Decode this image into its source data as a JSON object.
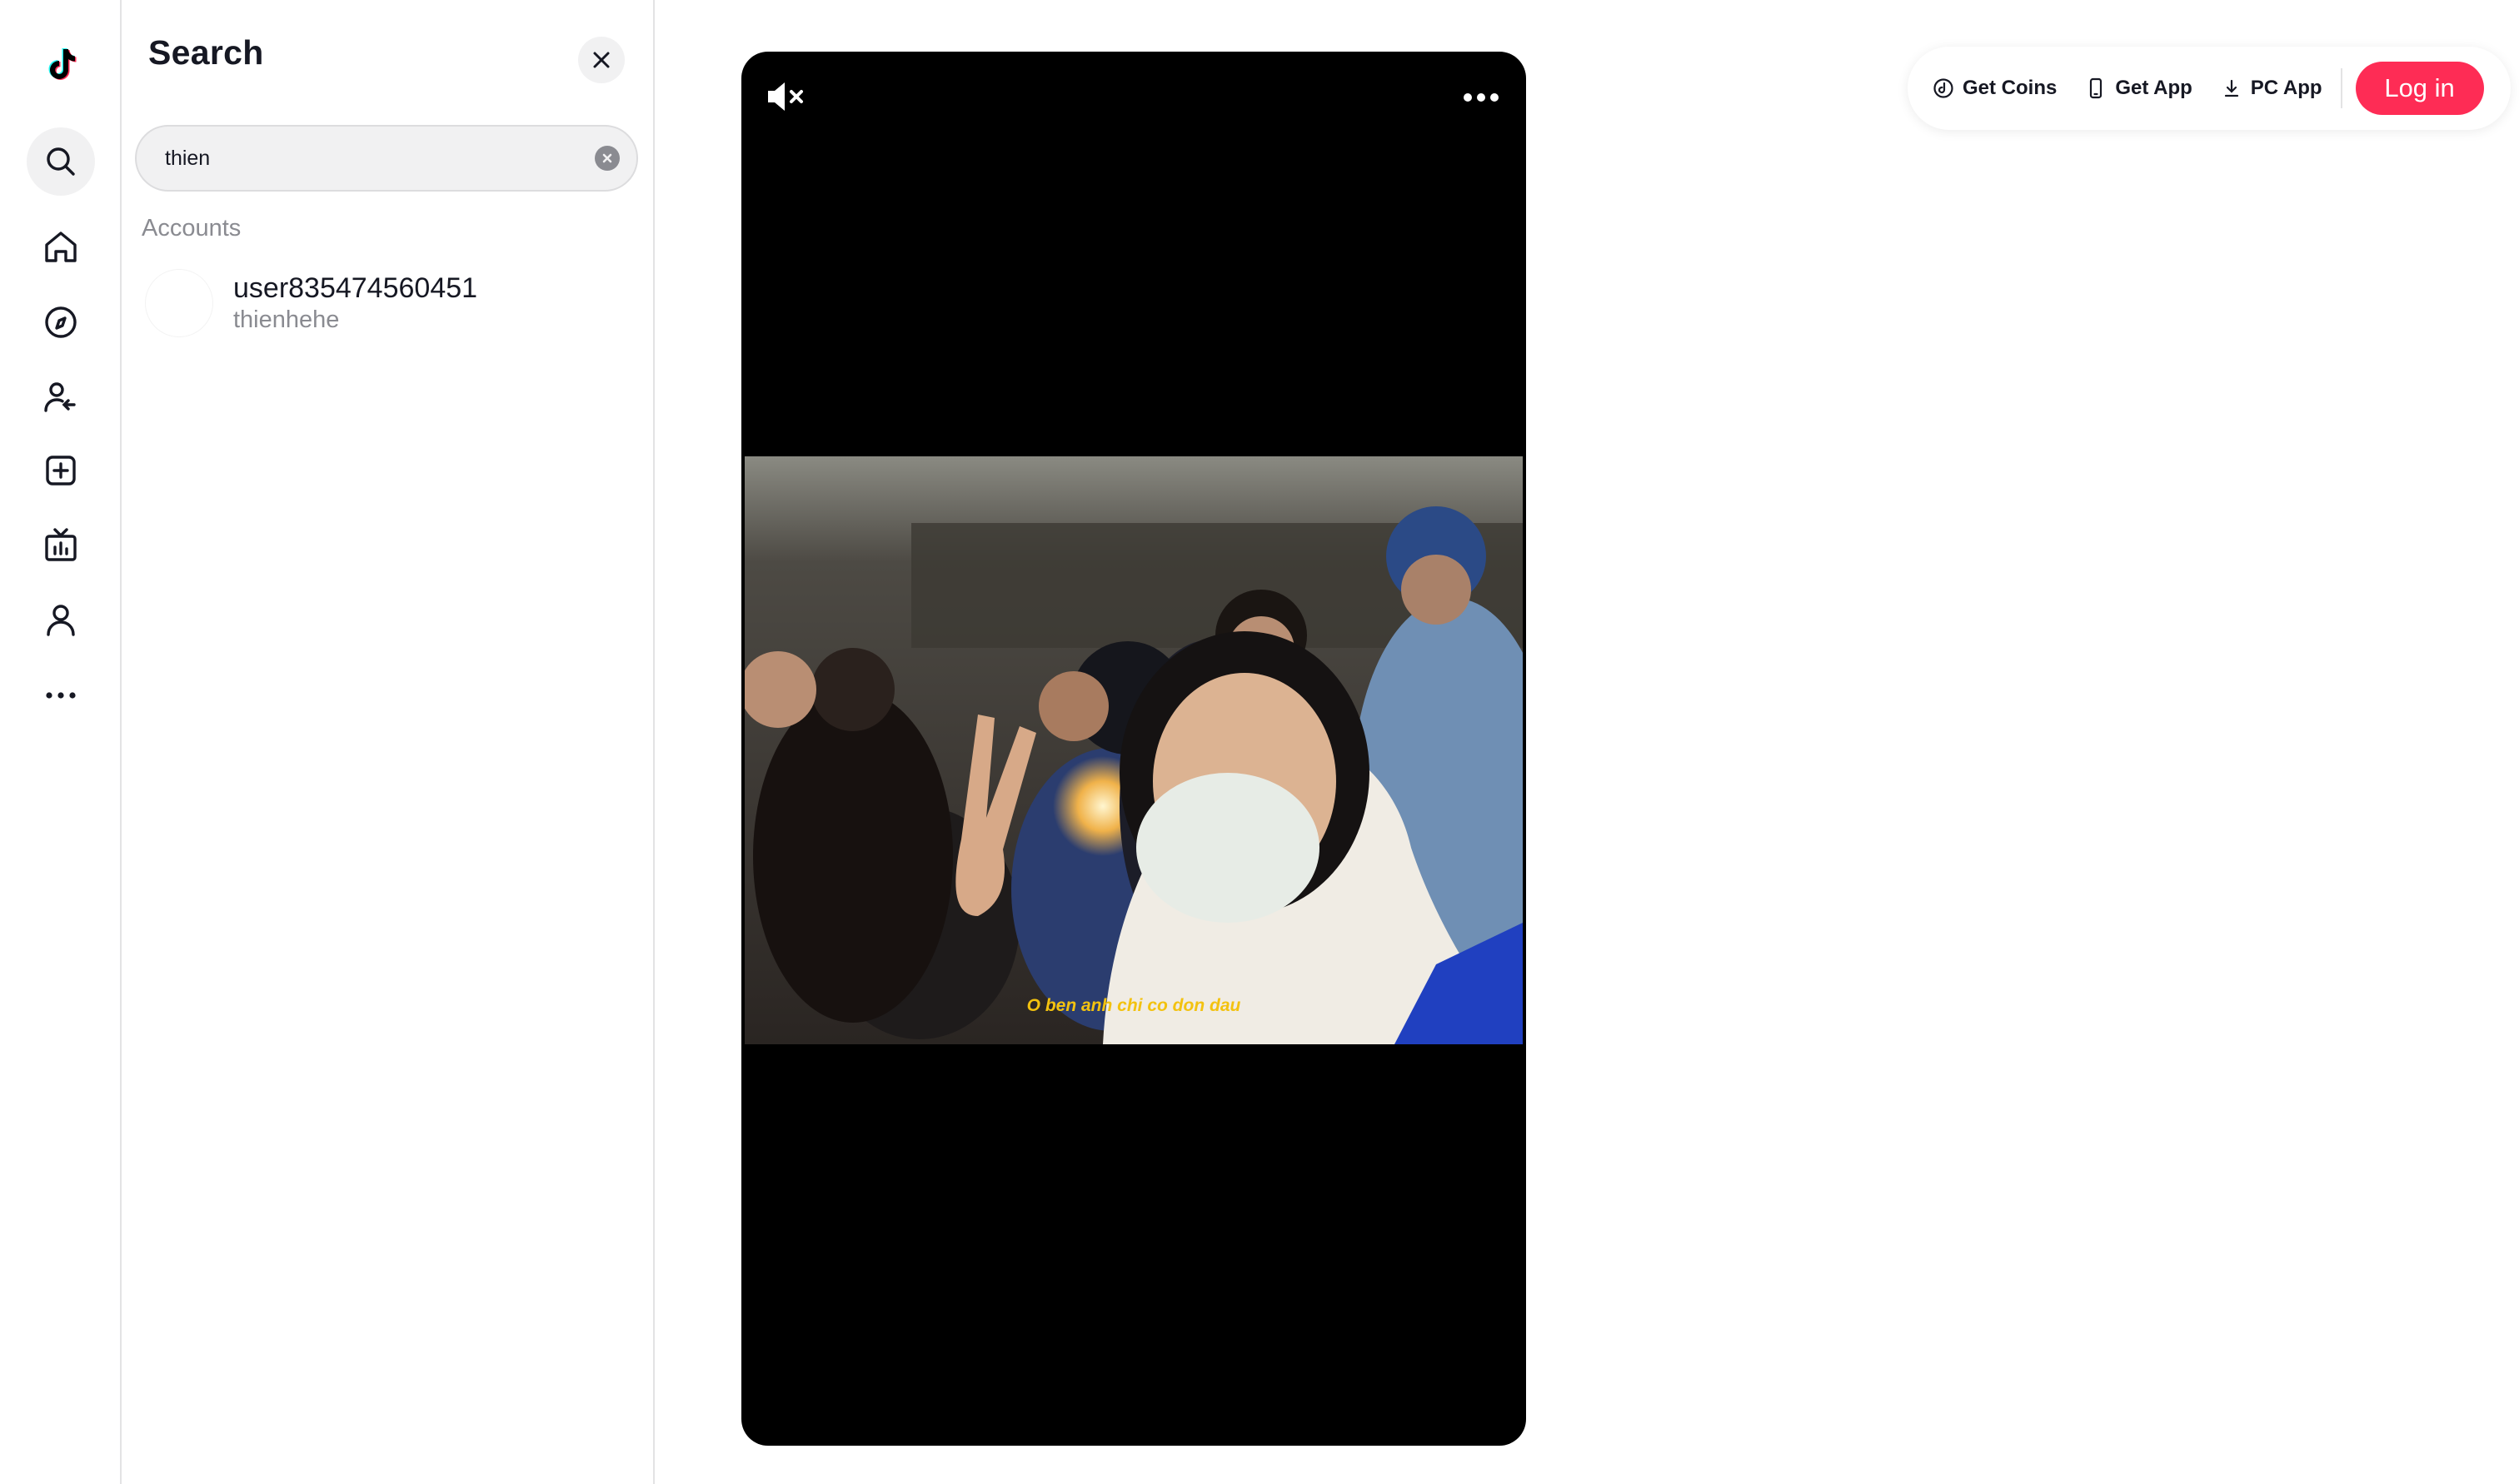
{
  "rail": {
    "items": [
      {
        "icon": "tiktok-logo"
      },
      {
        "icon": "search-icon",
        "active": true
      },
      {
        "icon": "home-icon"
      },
      {
        "icon": "explore-icon"
      },
      {
        "icon": "following-icon"
      },
      {
        "icon": "upload-icon"
      },
      {
        "icon": "live-icon"
      },
      {
        "icon": "profile-icon"
      },
      {
        "icon": "more-icon"
      }
    ]
  },
  "search": {
    "title": "Search",
    "query": "thien",
    "section_label": "Accounts",
    "results": [
      {
        "username": "user835474560451",
        "nickname": "thienhehe"
      }
    ]
  },
  "video": {
    "caption": "O ben anh chi co don dau",
    "muted": true
  },
  "top_bar": {
    "get_coins": "Get Coins",
    "get_app": "Get App",
    "pc_app": "PC App",
    "login": "Log in"
  },
  "colors": {
    "accent": "#fe2c55",
    "caption": "#f3c20f",
    "tiktok_cyan": "#25f4ee"
  }
}
